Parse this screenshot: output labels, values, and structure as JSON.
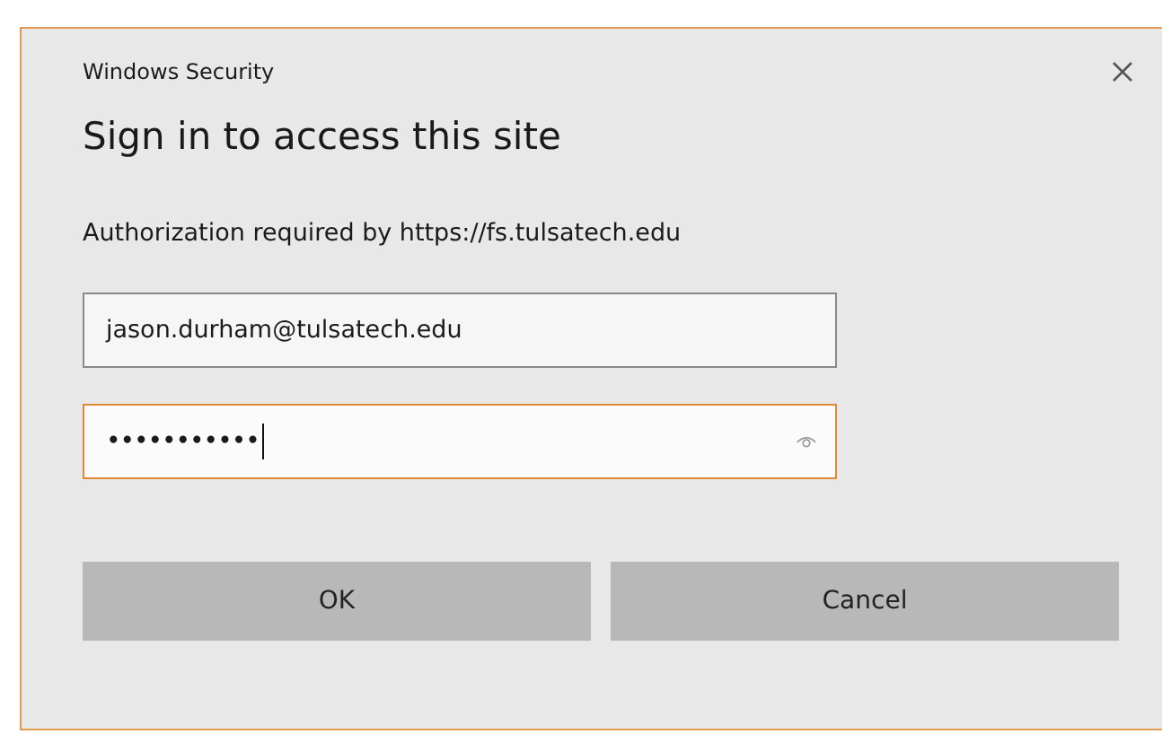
{
  "window": {
    "title": "Windows Security"
  },
  "heading": "Sign in to access this site",
  "message": "Authorization required by https://fs.tulsatech.edu",
  "fields": [
    {
      "kind": "text",
      "value": "jason.durham@tulsatech.edu",
      "focused": false
    },
    {
      "kind": "password",
      "value": "•••••••••••",
      "focused": true
    }
  ],
  "buttons": [
    "OK",
    "Cancel"
  ]
}
